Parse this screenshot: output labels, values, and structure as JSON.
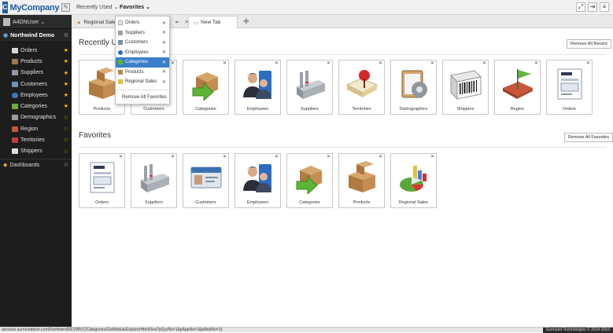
{
  "topbar": {
    "logo_letter": "C",
    "logo_text": "MyCompany",
    "nav": [
      {
        "label": "Recently Used ⌄"
      },
      {
        "label": "Favorites ⌄"
      }
    ]
  },
  "sidebar": {
    "user": "A4DNUser ⌄",
    "module": "Northwind Demo",
    "items": [
      {
        "label": "Orders",
        "star": "★"
      },
      {
        "label": "Products",
        "star": "★"
      },
      {
        "label": "Suppliers",
        "star": "★"
      },
      {
        "label": "Customers",
        "star": "★"
      },
      {
        "label": "Employees",
        "star": "★"
      },
      {
        "label": "Categories",
        "star": "★"
      },
      {
        "label": "Demographics",
        "star": "☆"
      },
      {
        "label": "Region",
        "star": "☆"
      },
      {
        "label": "Territories",
        "star": "☆"
      },
      {
        "label": "Shippers",
        "star": "☆"
      }
    ],
    "dashboards": "Dashboards"
  },
  "tabs": [
    {
      "label": "Regional Sales"
    },
    {
      "label": "New Tab"
    }
  ],
  "recent": {
    "title": "Recently Used",
    "remove_label": "Remove All Recent",
    "tiles": [
      "Products",
      "Customers",
      "Categories",
      "Employees",
      "Suppliers",
      "Territories",
      "Demographics",
      "Shippers",
      "Region",
      "Orders"
    ]
  },
  "favorites": {
    "title": "Favorites",
    "remove_label": "Remove All Favorites",
    "tiles": [
      "Orders",
      "Suppliers",
      "Customers",
      "Employees",
      "Categories",
      "Products",
      "Regional Sales"
    ]
  },
  "dropdown": {
    "items": [
      "Orders",
      "Suppliers",
      "Customers",
      "Employees",
      "Categories",
      "Products",
      "Regional Sales"
    ],
    "highlighted": "Categories",
    "remove_all": "Remove All Favorites"
  },
  "status": {
    "url": "services.surroundtech.com/NorthwindDEV/MVC/Categories/GetModuleExplorerHtmlView?pSysNo=1&pAppNo=1&pModNo=11",
    "copyright": "Surround Technologies © 2014-2016"
  }
}
